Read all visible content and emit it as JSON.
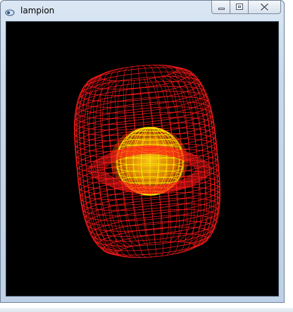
{
  "window": {
    "title": "lampion"
  },
  "icons": {
    "app": "app-icon",
    "minimize": "minimize-icon",
    "maximize": "restore-icon",
    "close": "close-icon"
  },
  "colors": {
    "wireframe_outer": "#ff1a1a",
    "wireframe_inner": "#ffee00",
    "inner_glow": "#ff8c00",
    "viewport_background": "#000000"
  }
}
